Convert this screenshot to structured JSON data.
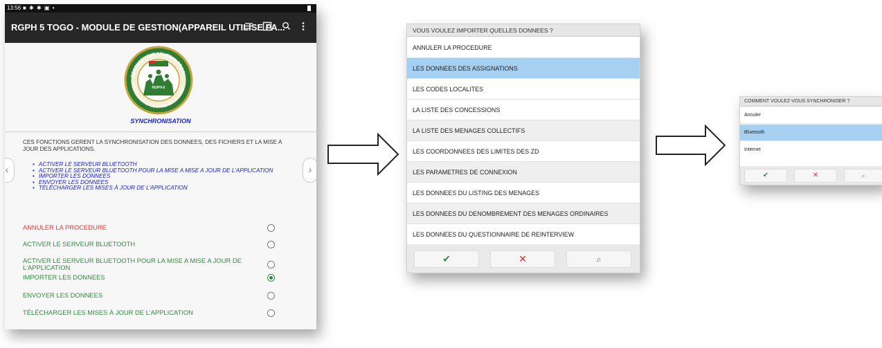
{
  "status_bar": {
    "time": "13:56",
    "icons": "■ ✱ ✱ ▣ •"
  },
  "app_bar": {
    "title": "RGPH 5 TOGO - MODULE DE GESTION(APPAREIL UTILISE PA...",
    "icons": [
      "menu-lines-icon",
      "edit-square-icon",
      "search-icon",
      "more-vertical-icon"
    ]
  },
  "logo": {
    "arc_top": "RECENSEMENT GÉNÉRAL DE LA",
    "arc_bottom": "POPULATION ET DE L'HABITAT AU TOGO",
    "badge": "RGPH-5"
  },
  "sync_title": "SYNCHRONISATION",
  "intro": "CES FONCTIONS GERENT LA SYNCHRONISATION DES DONNEES, DES FICHIERS ET LA MISE A JOUR DES APPLICATIONS.",
  "functions": [
    "ACTIVER LE SERVEUR BLUETOOTH",
    "ACTIVER LE SERVEUR BLUETOOTH POUR LA MISE A MISE A JOUR DE L'APPLICATION",
    "IMPORTER LES DONNEES",
    "ENVOYER LES DONNEES",
    "TÉLÉCHARGER LES MISES À JOUR DE L'APPLICATION"
  ],
  "options": [
    {
      "label": "ANNULER LA PROCEDURE",
      "selected": false,
      "color": "#e53935"
    },
    {
      "label": "ACTIVER LE SERVEUR BLUETOOTH",
      "selected": false,
      "color": "#2e8b3d"
    },
    {
      "label": "ACTIVER LE SERVEUR BLUETOOTH POUR LA MISE A MISE A JOUR DE L'APPLICATION",
      "selected": false,
      "color": "#2e8b3d"
    },
    {
      "label": "IMPORTER LES DONNEES",
      "selected": true,
      "color": "#2e8b3d"
    },
    {
      "label": "ENVOYER LES DONNEES",
      "selected": false,
      "color": "#2e8b3d"
    },
    {
      "label": "TÉLÉCHARGER LES MISES À JOUR DE L'APPLICATION",
      "selected": false,
      "color": "#2e8b3d"
    }
  ],
  "import_dialog": {
    "title": "VOUS VOULEZ IMPORTER QUELLES DONNEES ?",
    "items": [
      "ANNULER LA PROCEDURE",
      "LES DONNEES DES ASSIGNATIONS",
      "LES CODES LOCALITES",
      "LA LISTE DES CONCESSIONS",
      "LA LISTE DES MENAGES COLLECTIFS",
      "LES COORDONNEES DES LIMITES DES ZD",
      "LES PARAMETRES DE CONNEXION",
      "LES DONNEES DU LISTING DES MENAGES",
      "LES DONNEES DU DENOMBREMENT DES MENAGES ORDINAIRES",
      "LES DONNEES DU QUESTIONNAIRE DE REINTERVIEW"
    ],
    "selected_index": 1,
    "buttons": {
      "ok": "✔",
      "cancel": "✕",
      "search": "⌕"
    }
  },
  "sync_dialog": {
    "title": "COMMENT VOULEZ-VOUS SYNCHRONISER ?",
    "items": [
      "Annuler",
      "Bluetooth",
      "Internet"
    ],
    "selected_index": 1,
    "buttons": {
      "ok": "✔",
      "cancel": "✕",
      "search": "⌕"
    }
  },
  "colors": {
    "appbar": "#262626",
    "accent_blue": "#1a22c8",
    "selected_row": "#a6d0f2",
    "ok_green": "#2e8b3d",
    "cancel_red": "#d32f2f"
  }
}
